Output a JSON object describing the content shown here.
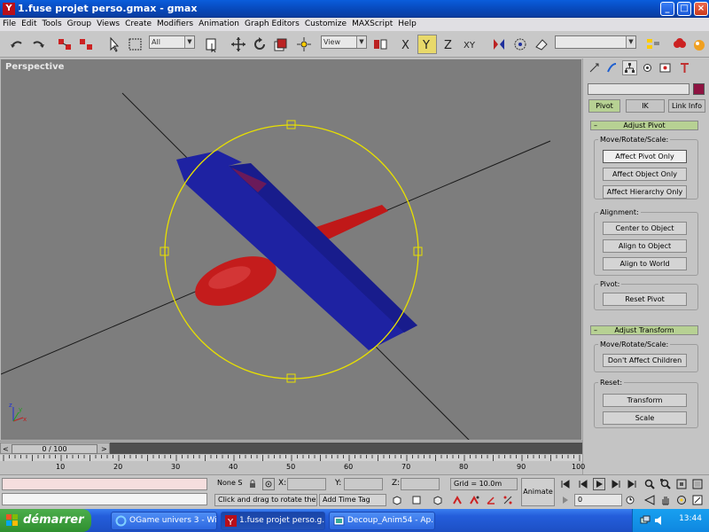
{
  "window": {
    "title": "1.fuse projet perso.gmax - gmax",
    "min_label": "_",
    "max_label": "□",
    "close_label": "×"
  },
  "menu": [
    "File",
    "Edit",
    "Tools",
    "Group",
    "Views",
    "Create",
    "Modifiers",
    "Animation",
    "Graph Editors",
    "Customize",
    "MAXScript",
    "Help"
  ],
  "toolbar": {
    "selection_filter": "All",
    "reference_coord": "View",
    "axis_x": "X",
    "axis_y": "Y",
    "axis_z": "Z",
    "axis_xy": "XY",
    "named_selection": ""
  },
  "viewport": {
    "label": "Perspective",
    "axis_labels": {
      "x": "x",
      "y": "y",
      "z": "z"
    }
  },
  "command_panel": {
    "object_name": "",
    "object_color": "#8e1341",
    "subtabs": {
      "pivot": "Pivot",
      "ik": "IK",
      "link": "Link Info"
    },
    "adjust_pivot": {
      "title": "Adjust Pivot",
      "group_move": "Move/Rotate/Scale:",
      "affect_pivot_only": "Affect Pivot Only",
      "affect_object_only": "Affect Object Only",
      "affect_hierarchy_only": "Affect Hierarchy Only",
      "group_alignment": "Alignment:",
      "center_to_object": "Center to Object",
      "align_to_object": "Align to Object",
      "align_to_world": "Align to World",
      "group_pivot": "Pivot:",
      "reset_pivot": "Reset Pivot"
    },
    "adjust_transform": {
      "title": "Adjust Transform",
      "group_move": "Move/Rotate/Scale:",
      "dont_affect_children": "Don't Affect Children",
      "group_reset": "Reset:",
      "transform": "Transform",
      "scale": "Scale"
    }
  },
  "time": {
    "slider_label": "0 / 100",
    "ruler_ticks": [
      "10",
      "20",
      "30",
      "40",
      "50",
      "60",
      "70",
      "80",
      "90",
      "100"
    ]
  },
  "status": {
    "selection": "None S",
    "x_label": "X:",
    "y_label": "Y:",
    "z_label": "Z:",
    "x_value": "",
    "y_value": "",
    "z_value": "",
    "grid": "Grid = 10.0m",
    "prompt": "Click and drag to rotate the vie",
    "add_time_tag": "Add Time Tag",
    "animate": "Animate",
    "frame": "0"
  },
  "taskbar": {
    "start_label": "démarrer",
    "tasks": [
      {
        "label": "OGame univers 3 - Wi..."
      },
      {
        "label": "1.fuse projet perso.g..."
      },
      {
        "label": "Decoup_Anim54 - Ap..."
      }
    ],
    "clock": "13:44"
  }
}
